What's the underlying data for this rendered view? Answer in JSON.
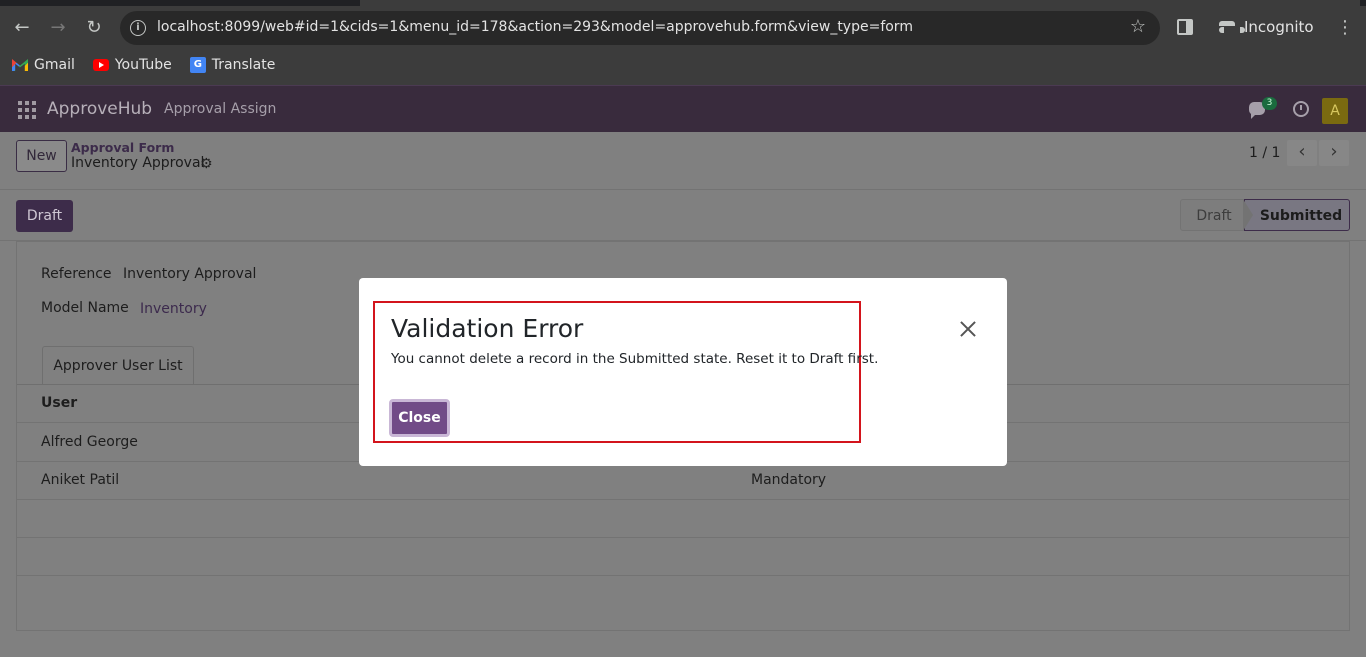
{
  "browser": {
    "url": "localhost:8099/web#id=1&cids=1&menu_id=178&action=293&model=approvehub.form&view_type=form",
    "profile_label": "Incognito",
    "bookmarks": [
      {
        "label": "Gmail",
        "icon": "gmail-icon"
      },
      {
        "label": "YouTube",
        "icon": "youtube-icon"
      },
      {
        "label": "Translate",
        "icon": "translate-icon"
      }
    ]
  },
  "navbar": {
    "brand": "ApproveHub",
    "menu_item": "Approval Assign",
    "chat_badge": "3",
    "avatar_letter": "A"
  },
  "control_panel": {
    "new_label": "New",
    "breadcrumb_parent": "Approval Form",
    "breadcrumb_current": "Inventory Approval",
    "pager": "1 / 1"
  },
  "statusbar": {
    "draft_button": "Draft",
    "stages": [
      "Draft",
      "Submitted"
    ],
    "active_stage": "Submitted"
  },
  "form": {
    "reference_label": "Reference",
    "reference_value": "Inventory Approval",
    "model_label": "Model Name",
    "model_value": "Inventory",
    "tab_label": "Approver User List",
    "column_user": "User",
    "rows": [
      {
        "user": "Alfred George",
        "type": ""
      },
      {
        "user": "Aniket Patil",
        "type": "Mandatory"
      }
    ]
  },
  "dialog": {
    "title": "Validation Error",
    "message": "You cannot delete a record in the Submitted state. Reset it to Draft first.",
    "close_label": "Close"
  },
  "colors": {
    "navbar": "#392b3d",
    "primary": "#714b87",
    "highlight_border": "#d3141c"
  }
}
